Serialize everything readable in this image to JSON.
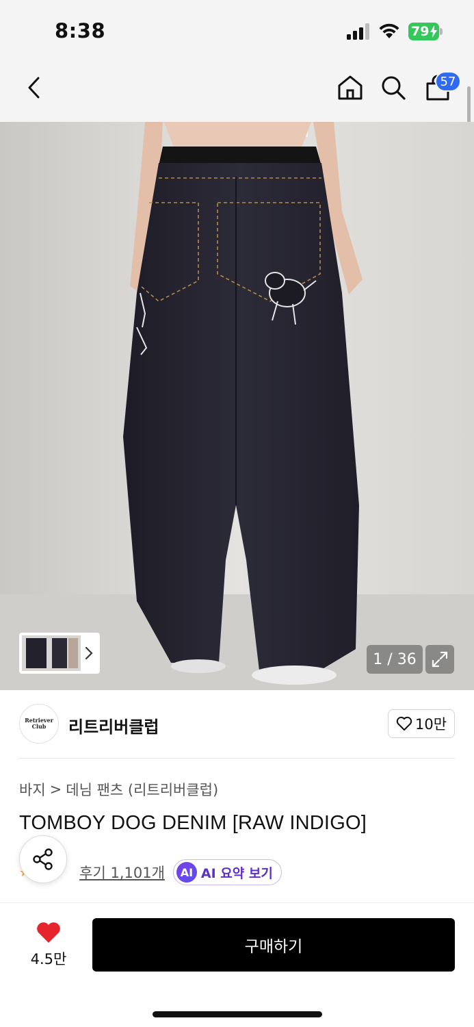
{
  "status_bar": {
    "time": "8:38",
    "battery": "79",
    "icons": [
      "signal-icon",
      "wifi-icon",
      "battery-icon"
    ]
  },
  "nav": {
    "icons": [
      "back-icon",
      "home-icon",
      "search-icon",
      "cart-icon"
    ],
    "cart_count": "57"
  },
  "gallery": {
    "counter": "1 / 36",
    "icons": [
      "chevron-right-icon",
      "expand-icon"
    ]
  },
  "brand": {
    "name": "리트리버클럽",
    "logo_text_1": "Retriever",
    "logo_text_2": "Club",
    "like_count": "10만"
  },
  "breadcrumb": {
    "category": "바지",
    "separator": ">",
    "subcategory": "데님 팬츠 (리트리버클럽)"
  },
  "product": {
    "title": "TOMBOY DOG DENIM [RAW INDIGO]"
  },
  "reviews": {
    "link_label": "후기 1,101개",
    "ai_badge": "AI",
    "ai_summary_label": "AI 요약 보기"
  },
  "bottom_bar": {
    "wish_count": "4.5만",
    "buy_label": "구매하기"
  },
  "colors": {
    "accent_blue": "#2f6bf0",
    "heart_red": "#e5242b",
    "ai_purple": "#5b2fc9",
    "battery_green": "#34c759"
  }
}
